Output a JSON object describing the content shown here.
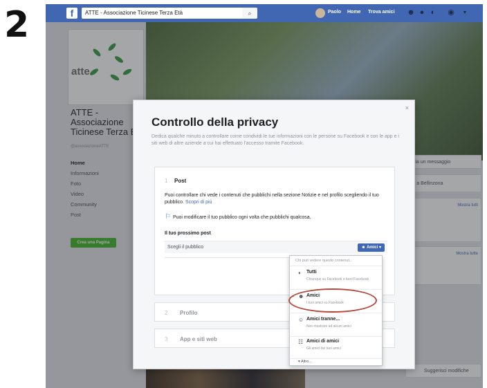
{
  "step": "2",
  "topbar": {
    "logo": "f",
    "search_value": "ATTE - Associazione Ticinese Terza Età",
    "search_icon": "search-icon",
    "user_name": "Paolo",
    "nav": [
      "Home",
      "Trova amici"
    ],
    "icons": [
      "friends-icon",
      "messenger-icon",
      "globe-icon",
      "help-icon",
      "caret-down-icon"
    ],
    "accent": "#4267b2"
  },
  "page": {
    "logo_text": "atte",
    "title": "ATTE - Associazione Ticinese Terza Età",
    "handle": "@associazioneATTE",
    "nav": [
      "Home",
      "Informazioni",
      "Foto",
      "Video",
      "Community",
      "Post"
    ],
    "create_page_button": "Crea una Pagina",
    "right_cards": [
      "Invia un messaggio",
      "ofit a Bellinzona",
      "Mostra tutti",
      "Mostra tutte",
      "Suggerisci modifiche"
    ]
  },
  "modal": {
    "title": "Controllo della privacy",
    "description": "Dedica qualche minuto a controllare come condividi le tue informazioni con le persone su Facebook e con le app e i siti web di altre aziende a cui hai effettuato l'accesso tramite Facebook.",
    "close": "×",
    "sections": [
      {
        "num": "1",
        "title": "Post"
      },
      {
        "num": "2",
        "title": "Profilo"
      },
      {
        "num": "3",
        "title": "App e siti web"
      }
    ],
    "post": {
      "text": "Puoi controllare chi vede i contenuti che pubblichi nella sezione Notizie e nel profilo scegliendo il tuo pubblico.",
      "link": "Scopri di più",
      "tip": "Puoi modificare il tuo pubblico ogni volta che pubblichi qualcosa.",
      "next_post_label": "Il tuo prossimo post",
      "choose_label": "Scegli il pubblico",
      "audience_button": "Amici ▾"
    }
  },
  "dropdown": {
    "header": "Chi può vedere questo contenut...",
    "items": [
      {
        "label": "Tutti",
        "sub": "Chiunque su Facebook e fuori Facebook",
        "icon": "globe-icon",
        "selected": false
      },
      {
        "label": "Amici",
        "sub": "I tuoi amici su Facebook",
        "icon": "friends-icon",
        "selected": true
      },
      {
        "label": "Amici tranne...",
        "sub": "Non mostrare ad alcuni amici",
        "icon": "person-minus-icon",
        "selected": false
      },
      {
        "label": "Amici di amici",
        "sub": "Gli amici dei tuoi amici",
        "icon": "friends-of-friends-icon",
        "selected": false
      }
    ],
    "more": "▾ Altro...",
    "check": "✓"
  }
}
